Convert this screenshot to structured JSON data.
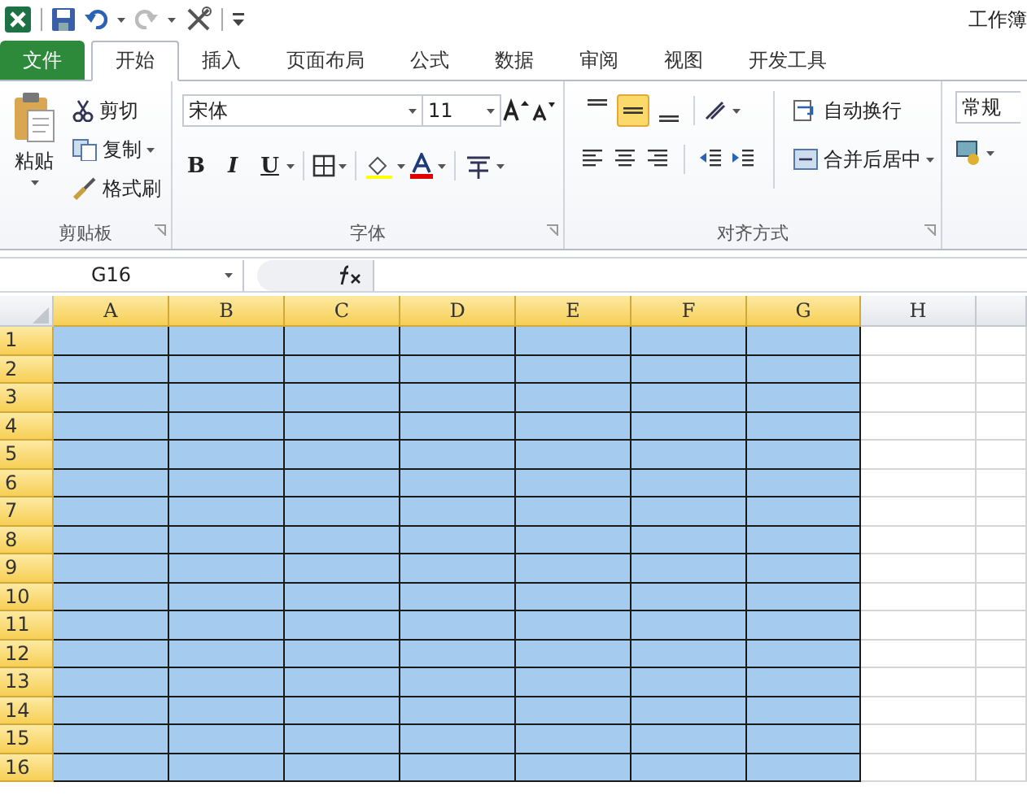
{
  "window": {
    "title": "工作簿"
  },
  "tabs": [
    {
      "label": "文件",
      "kind": "file",
      "selected": false
    },
    {
      "label": "开始",
      "kind": "tab",
      "selected": true
    },
    {
      "label": "插入",
      "kind": "tab",
      "selected": false
    },
    {
      "label": "页面布局",
      "kind": "tab",
      "selected": false
    },
    {
      "label": "公式",
      "kind": "tab",
      "selected": false
    },
    {
      "label": "数据",
      "kind": "tab",
      "selected": false
    },
    {
      "label": "审阅",
      "kind": "tab",
      "selected": false
    },
    {
      "label": "视图",
      "kind": "tab",
      "selected": false
    },
    {
      "label": "开发工具",
      "kind": "tab",
      "selected": false
    }
  ],
  "clipboard": {
    "paste": "粘贴",
    "cut": "剪切",
    "copy": "复制",
    "format_painter": "格式刷",
    "label": "剪贴板"
  },
  "font": {
    "font_name": "宋体",
    "font_size": "11",
    "bold": "B",
    "italic": "I",
    "underline": "U",
    "label": "字体"
  },
  "alignment": {
    "vertical": [
      {
        "kind": "top",
        "selected": false
      },
      {
        "kind": "middle",
        "selected": true
      },
      {
        "kind": "bottom",
        "selected": false
      }
    ],
    "wrap_text": "自动换行",
    "merge_center": "合并后居中",
    "label": "对齐方式"
  },
  "number": {
    "format": "常规"
  },
  "formula_bar": {
    "name_box": "G16"
  },
  "sheet": {
    "columns": [
      {
        "label": "A",
        "selected": true
      },
      {
        "label": "B",
        "selected": true
      },
      {
        "label": "C",
        "selected": true
      },
      {
        "label": "D",
        "selected": true
      },
      {
        "label": "E",
        "selected": true
      },
      {
        "label": "F",
        "selected": true
      },
      {
        "label": "G",
        "selected": true
      },
      {
        "label": "H",
        "selected": false
      }
    ],
    "rows": [
      {
        "label": "1",
        "selected": true
      },
      {
        "label": "2",
        "selected": true
      },
      {
        "label": "3",
        "selected": true
      },
      {
        "label": "4",
        "selected": true
      },
      {
        "label": "5",
        "selected": true
      },
      {
        "label": "6",
        "selected": true
      },
      {
        "label": "7",
        "selected": true
      },
      {
        "label": "8",
        "selected": true
      },
      {
        "label": "9",
        "selected": true
      },
      {
        "label": "10",
        "selected": true
      },
      {
        "label": "11",
        "selected": true
      },
      {
        "label": "12",
        "selected": true
      },
      {
        "label": "13",
        "selected": true
      },
      {
        "label": "14",
        "selected": true
      },
      {
        "label": "15",
        "selected": true
      },
      {
        "label": "16",
        "selected": true
      }
    ]
  }
}
